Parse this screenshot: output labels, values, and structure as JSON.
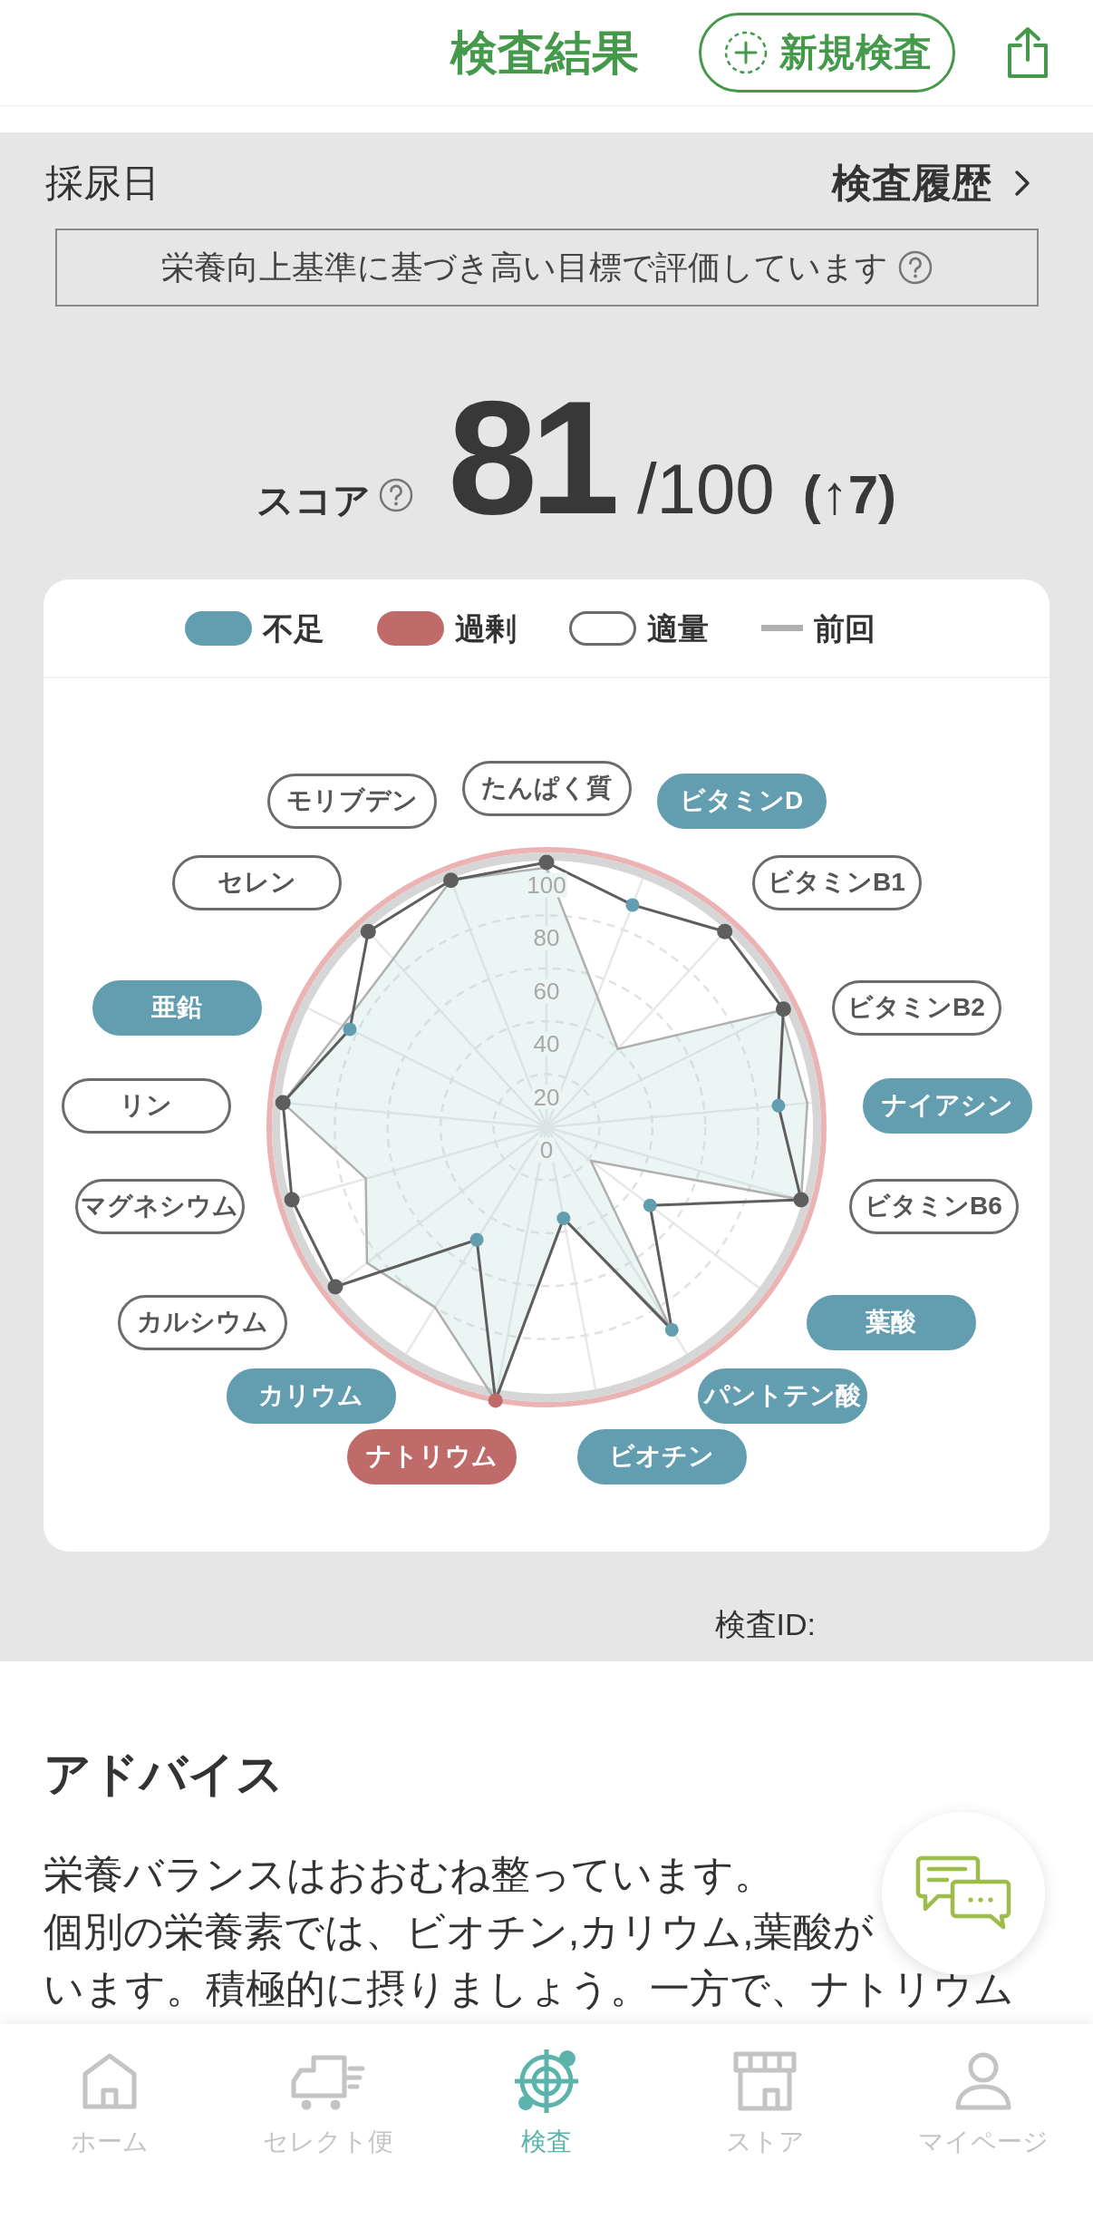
{
  "header": {
    "title": "検査結果",
    "new_test_button": "新規検査"
  },
  "sample": {
    "date_label": "採尿日",
    "history_link": "検査履歴"
  },
  "notice": "栄養向上基準に基づき高い目標で評価しています",
  "score": {
    "label": "スコア",
    "value": "81",
    "max": "/100",
    "change": "(↑7)"
  },
  "chart": {
    "legend": [
      {
        "label": "不足",
        "kind": "deficient"
      },
      {
        "label": "過剰",
        "kind": "excess"
      },
      {
        "label": "適量",
        "kind": "adequate"
      }
    ],
    "nutrient_tags": [
      {
        "kind": "adequate"
      },
      {
        "kind": "deficient"
      },
      {
        "kind": "adequate"
      },
      {
        "kind": "adequate"
      },
      {
        "kind": "deficient"
      },
      {
        "kind": "adequate"
      },
      {
        "kind": "deficient"
      },
      {
        "kind": "deficient"
      },
      {
        "kind": "deficient"
      },
      {
        "kind": "excess"
      },
      {
        "kind": "deficient"
      },
      {
        "kind": "adequate"
      },
      {
        "kind": "adequate"
      },
      {
        "kind": "adequate"
      },
      {
        "kind": "deficient"
      },
      {
        "kind": "adequate"
      },
      {
        "kind": "adequate"
      }
    ],
    "chart_data": {
      "type": "radar",
      "categories": [
        "たんぱく質",
        "ビタミンD",
        "ビタミンB1",
        "ビタミンB2",
        "ナイアシン",
        "ビタミンB6",
        "葉酸",
        "パントテン酸",
        "ビオチン",
        "ナトリウム",
        "カリウム",
        "カルシウム",
        "マグネシウム",
        "リン",
        "亜鉛",
        "セレン",
        "モリブデン"
      ],
      "ylim": [
        0,
        105
      ],
      "yticks": [
        0,
        20,
        40,
        60,
        80,
        100
      ],
      "series": [
        {
          "name": "前回",
          "color": "#b0b0b0",
          "values": [
            98,
            53,
            40,
            99,
            99,
            100,
            21,
            88,
            35,
            105,
            80,
            85,
            71,
            100,
            86,
            86,
            100
          ]
        },
        {
          "color": "#5e5e5e",
          "values": [
            100,
            90,
            100,
            100,
            88,
            100,
            49,
            90,
            35,
            105,
            50,
            100,
            100,
            100,
            83,
            100,
            100
          ]
        }
      ]
    }
  },
  "test_id": "検査ID:",
  "advice": {
    "title": "アドバイス",
    "lines": [
      "栄養バランスはおおむね整っています。",
      "個別の栄養素では、ビオチン,カリウム,葉酸が",
      "います。積極的に摂りましょう。一方で、ナトリウム"
    ]
  },
  "tab_bar": [
    {
      "label": "ホーム",
      "selected": false
    },
    {
      "label": "セレクト便",
      "selected": false
    },
    {
      "label": "検査",
      "selected": true
    },
    {
      "label": "ストア",
      "selected": false
    },
    {
      "label": "マイページ",
      "selected": false
    }
  ]
}
